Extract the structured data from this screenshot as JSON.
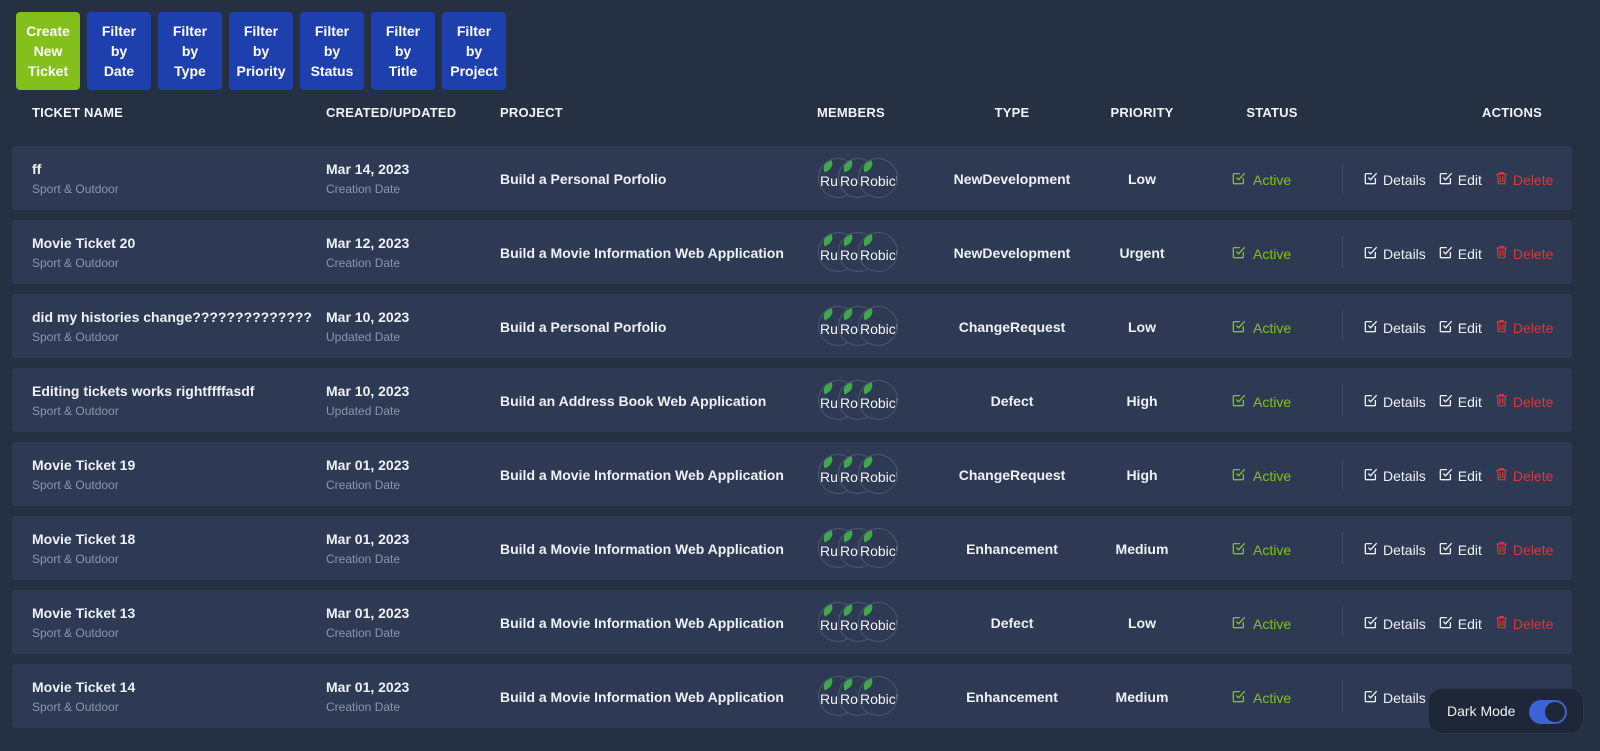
{
  "toolbar": {
    "buttons": [
      {
        "label": "Create\nNew\nTicket"
      },
      {
        "label": "Filter\nby\nDate"
      },
      {
        "label": "Filter\nby\nType"
      },
      {
        "label": "Filter\nby\nPriority"
      },
      {
        "label": "Filter\nby\nStatus"
      },
      {
        "label": "Filter\nby\nTitle"
      },
      {
        "label": "Filter\nby\nProject"
      }
    ]
  },
  "table": {
    "headers": {
      "name": "TICKET NAME",
      "date": "CREATED/UPDATED",
      "project": "PROJECT",
      "members": "MEMBERS",
      "type": "TYPE",
      "priority": "PRIORITY",
      "status": "STATUS",
      "actions": "ACTIONS"
    },
    "action_labels": {
      "details": "Details",
      "edit": "Edit",
      "delete": "Delete"
    },
    "member_avatars": [
      "Ru",
      "Ro",
      "Robick"
    ],
    "rows": [
      {
        "name": "ff",
        "sub": "Sport & Outdoor",
        "date": "Mar 14, 2023",
        "date_sub": "Creation Date",
        "project": "Build a Personal Porfolio",
        "type": "NewDevelopment",
        "priority": "Low",
        "status": "Active"
      },
      {
        "name": "Movie Ticket 20",
        "sub": "Sport & Outdoor",
        "date": "Mar 12, 2023",
        "date_sub": "Creation Date",
        "project": "Build a Movie Information Web Application",
        "type": "NewDevelopment",
        "priority": "Urgent",
        "status": "Active"
      },
      {
        "name": "did my histories change??????????????",
        "sub": "Sport & Outdoor",
        "date": "Mar 10, 2023",
        "date_sub": "Updated Date",
        "project": "Build a Personal Porfolio",
        "type": "ChangeRequest",
        "priority": "Low",
        "status": "Active"
      },
      {
        "name": "Editing tickets works rightffffasdf",
        "sub": "Sport & Outdoor",
        "date": "Mar 10, 2023",
        "date_sub": "Updated Date",
        "project": "Build an Address Book Web Application",
        "type": "Defect",
        "priority": "High",
        "status": "Active"
      },
      {
        "name": "Movie Ticket 19",
        "sub": "Sport & Outdoor",
        "date": "Mar 01, 2023",
        "date_sub": "Creation Date",
        "project": "Build a Movie Information Web Application",
        "type": "ChangeRequest",
        "priority": "High",
        "status": "Active"
      },
      {
        "name": "Movie Ticket 18",
        "sub": "Sport & Outdoor",
        "date": "Mar 01, 2023",
        "date_sub": "Creation Date",
        "project": "Build a Movie Information Web Application",
        "type": "Enhancement",
        "priority": "Medium",
        "status": "Active"
      },
      {
        "name": "Movie Ticket 13",
        "sub": "Sport & Outdoor",
        "date": "Mar 01, 2023",
        "date_sub": "Creation Date",
        "project": "Build a Movie Information Web Application",
        "type": "Defect",
        "priority": "Low",
        "status": "Active"
      },
      {
        "name": "Movie Ticket 14",
        "sub": "Sport & Outdoor",
        "date": "Mar 01, 2023",
        "date_sub": "Creation Date",
        "project": "Build a Movie Information Web Application",
        "type": "Enhancement",
        "priority": "Medium",
        "status": "Active"
      }
    ]
  },
  "dark_mode": {
    "label": "Dark Mode",
    "enabled": true
  },
  "colors": {
    "background": "#263043",
    "row": "#2e3a54",
    "create_button": "#84c01b",
    "filter_button": "#1e40af",
    "status_active": "#84c01b",
    "delete": "#d43a3a",
    "toggle": "#3b63d6"
  }
}
